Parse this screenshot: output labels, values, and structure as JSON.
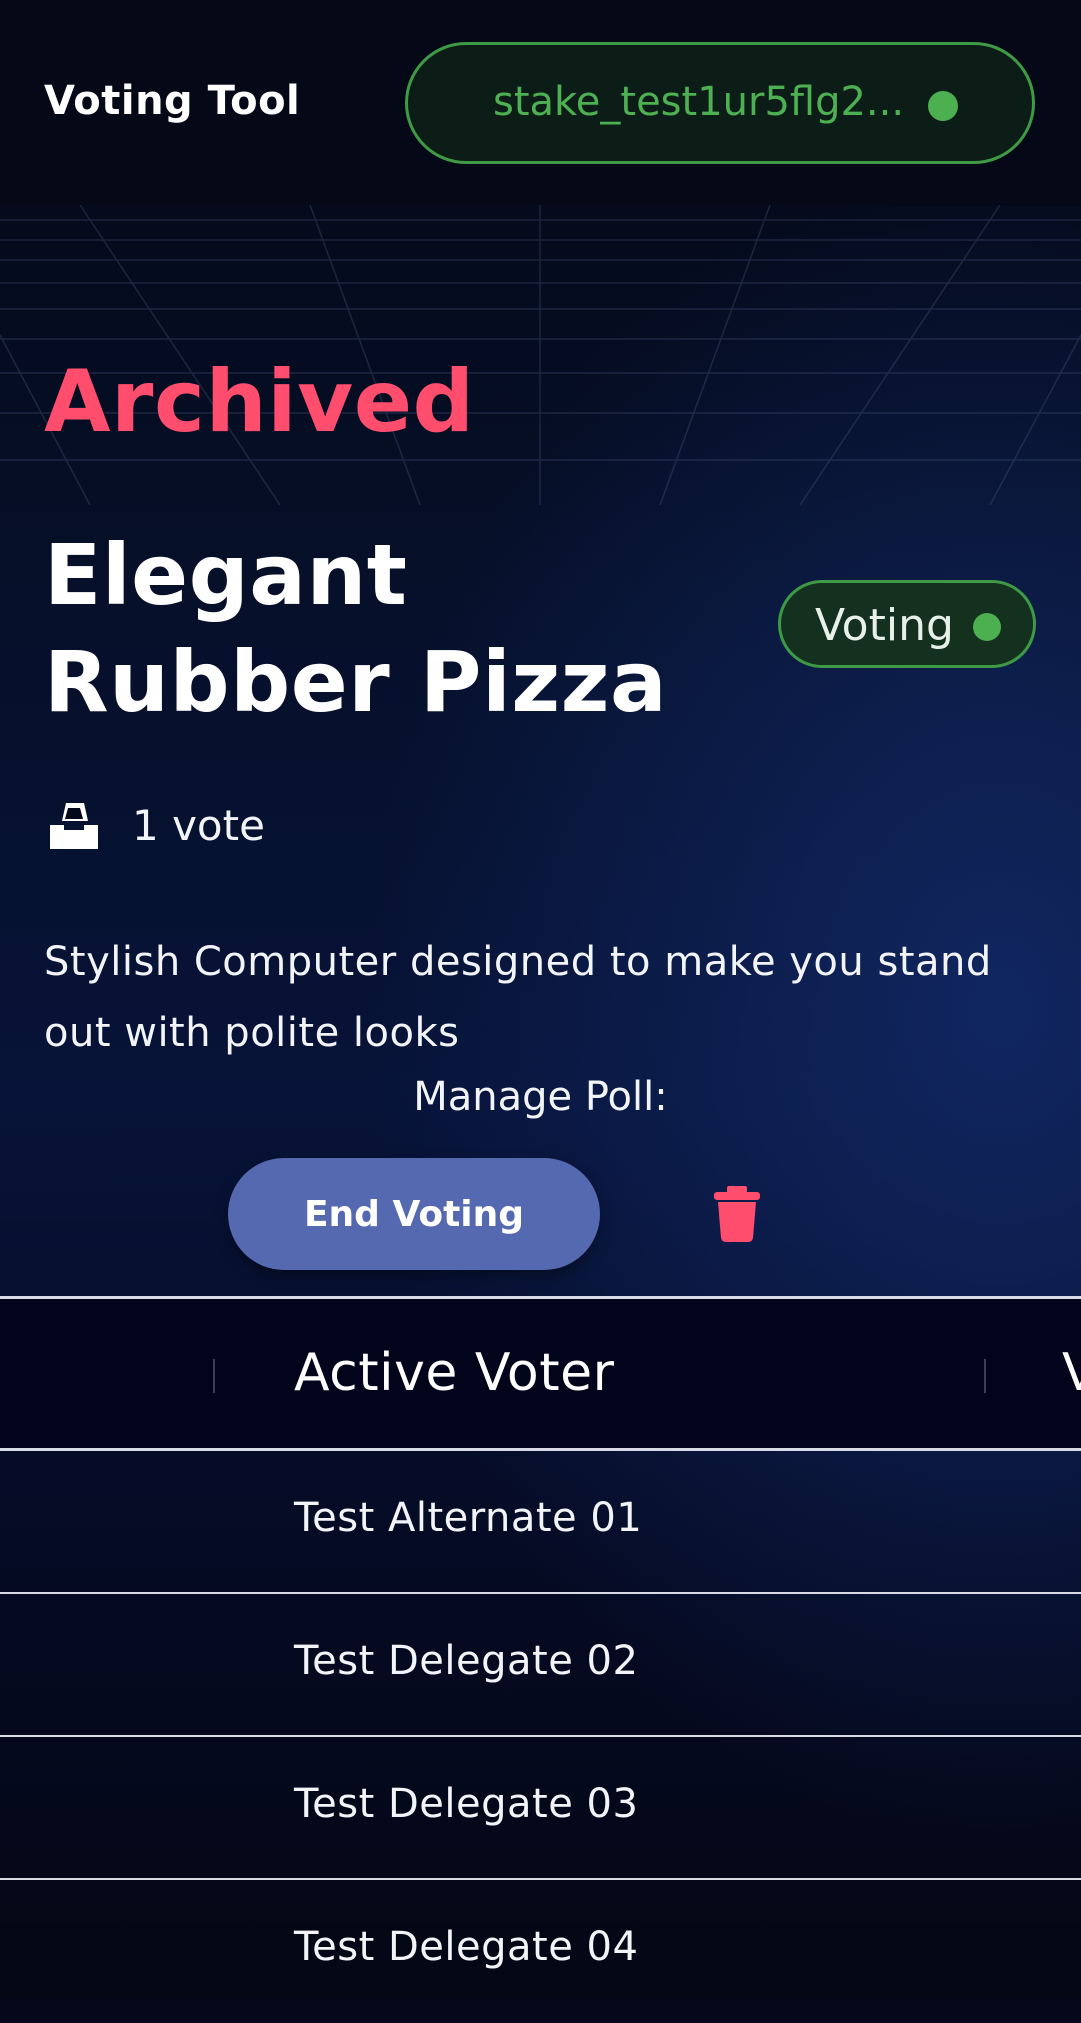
{
  "header": {
    "app_title": "Voting Tool",
    "wallet_address": "stake_test1ur5flg2...",
    "wallet_status_color": "#4caf50"
  },
  "poll": {
    "archived_label": "Archived",
    "title": "Elegant Rubber Pizza",
    "status_label": "Voting",
    "status_color": "#4caf50",
    "vote_count": "1 vote",
    "description": "Stylish Computer designed to make you stand out with polite looks"
  },
  "manage": {
    "label": "Manage Poll:",
    "end_voting_label": "End Voting",
    "delete_icon": "trash-icon"
  },
  "table": {
    "columns": [
      "Active Voter",
      "V"
    ],
    "rows": [
      {
        "voter": "Test Alternate 01"
      },
      {
        "voter": "Test Delegate 02"
      },
      {
        "voter": "Test Delegate 03"
      },
      {
        "voter": "Test Delegate 04"
      }
    ]
  },
  "colors": {
    "accent_red": "#ff4d6d",
    "button_blue": "#5569b0",
    "success_green": "#4caf50"
  }
}
